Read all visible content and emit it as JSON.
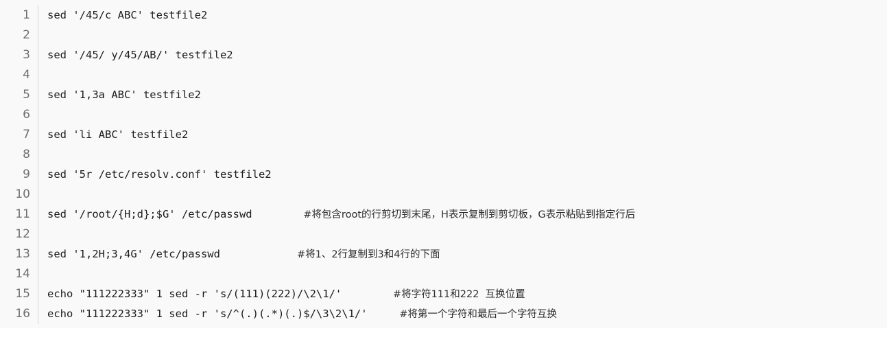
{
  "document": {
    "type": "code-listing",
    "language": "shell",
    "topic": "sed command examples"
  },
  "editor": {
    "background_color": "#f9f9f9",
    "gutter_text_color": "#6f6f6f",
    "code_text_color": "#1b1b1b",
    "comment_text_color": "#2b2b2b",
    "gutter_separator_color": "#d4d4d4"
  },
  "lines": [
    {
      "number": "1",
      "code": "sed '/45/c ABC' testfile2",
      "comment": ""
    },
    {
      "number": "2",
      "code": "",
      "comment": ""
    },
    {
      "number": "3",
      "code": "sed '/45/ y/45/AB/' testfile2",
      "comment": ""
    },
    {
      "number": "4",
      "code": "",
      "comment": ""
    },
    {
      "number": "5",
      "code": "sed '1,3a ABC' testfile2",
      "comment": ""
    },
    {
      "number": "6",
      "code": "",
      "comment": ""
    },
    {
      "number": "7",
      "code": "sed 'li ABC' testfile2",
      "comment": ""
    },
    {
      "number": "8",
      "code": "",
      "comment": ""
    },
    {
      "number": "9",
      "code": "sed '5r /etc/resolv.conf' testfile2",
      "comment": ""
    },
    {
      "number": "10",
      "code": "",
      "comment": ""
    },
    {
      "number": "11",
      "code": "sed '/root/{H;d};$G' /etc/passwd        ",
      "comment": "#将包含root的行剪切到末尾，H表示复制到剪切板，G表示粘贴到指定行后"
    },
    {
      "number": "12",
      "code": "",
      "comment": ""
    },
    {
      "number": "13",
      "code": "sed '1,2H;3,4G' /etc/passwd            ",
      "comment": "#将1、2行复制到3和4行的下面"
    },
    {
      "number": "14",
      "code": "",
      "comment": ""
    },
    {
      "number": "15",
      "code": "echo \"111222333\" 1 sed -r 's/(111)(222)/\\2\\1/'        ",
      "comment": "#将字符111和222  互换位置"
    },
    {
      "number": "16",
      "code": "echo \"111222333\" 1 sed -r 's/^(.)(.*)(.)$/\\3\\2\\1/'     ",
      "comment": "#将第一个字符和最后一个字符互换"
    }
  ]
}
